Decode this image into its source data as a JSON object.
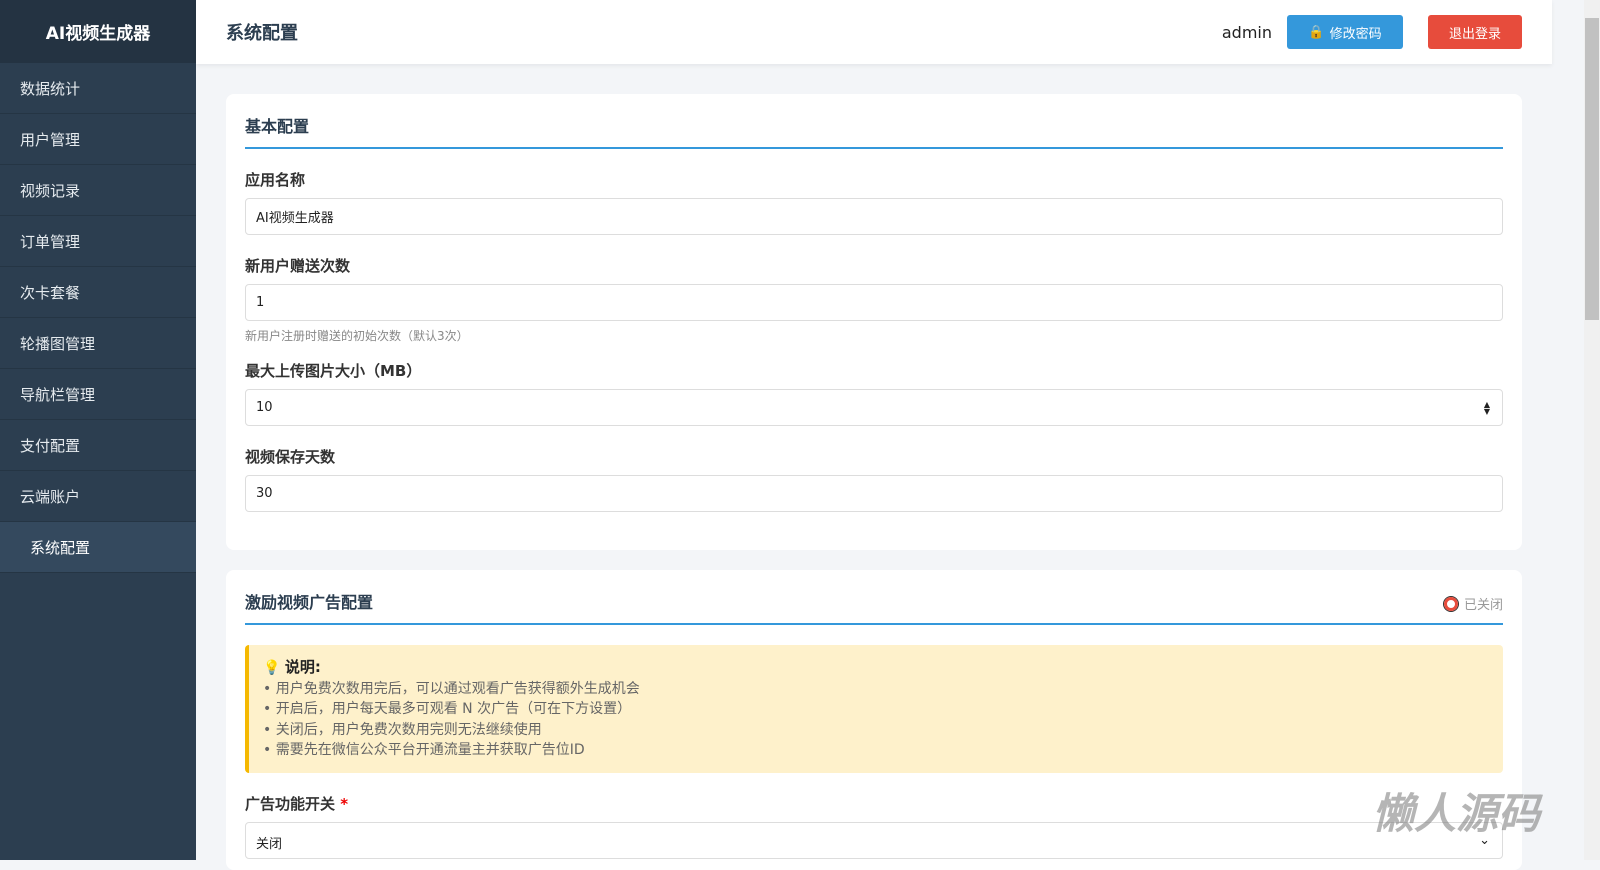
{
  "app": {
    "title": "AI视频生成器"
  },
  "sidebar": {
    "items": [
      "数据统计",
      "用户管理",
      "视频记录",
      "订单管理",
      "次卡套餐",
      "轮播图管理",
      "导航栏管理",
      "支付配置",
      "云端账户",
      "系统配置"
    ]
  },
  "header": {
    "title": "系统配置",
    "user": "admin",
    "change_password": "修改密码",
    "logout": "退出登录"
  },
  "basic": {
    "title": "基本配置",
    "app_name_label": "应用名称",
    "app_name": "AI视频生成器",
    "gift_label": "新用户赠送次数",
    "gift": "1",
    "gift_hint": "新用户注册时赠送的初始次数（默认3次）",
    "upload_label": "最大上传图片大小（MB）",
    "upload": "10",
    "days_label": "视频保存天数",
    "days": "30"
  },
  "ad": {
    "title": "激励视频广告配置",
    "status": "已关闭",
    "note_title": "说明:",
    "notes": [
      "• 用户免费次数用完后，可以通过观看广告获得额外生成机会",
      "• 开启后，用户每天最多可观看 N 次广告（可在下方设置）",
      "• 关闭后，用户免费次数用完则无法继续使用",
      "• 需要先在微信公众平台开通流量主并获取广告位ID"
    ],
    "switch_label": "广告功能开关",
    "switch_value": "关闭"
  },
  "watermark": "懒人源码"
}
